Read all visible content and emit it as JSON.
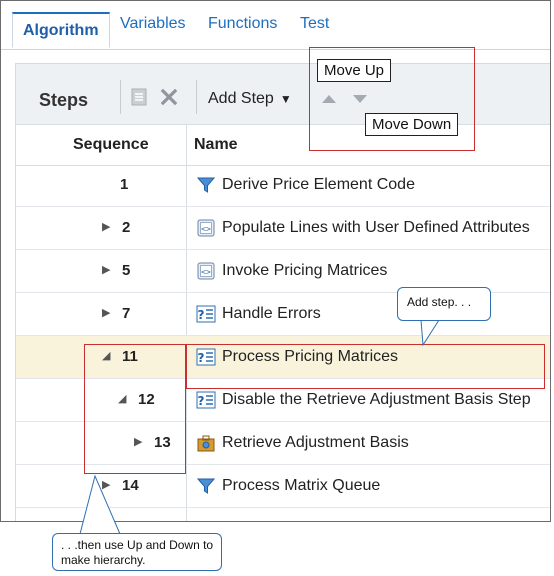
{
  "tabs": [
    {
      "label": "Algorithm",
      "active": true
    },
    {
      "label": "Variables",
      "active": false
    },
    {
      "label": "Functions",
      "active": false
    },
    {
      "label": "Test",
      "active": false
    }
  ],
  "toolbar": {
    "title": "Steps",
    "add_step_label": "Add Step",
    "icons": [
      "document-icon",
      "delete-x-icon",
      "move-up-arrow-icon",
      "move-down-arrow-icon"
    ]
  },
  "callouts": {
    "move_up": "Move Up",
    "move_down": "Move Down",
    "add_step_note": "Add step. . .",
    "hierarchy_note": ". . .then use Up and Down to make hierarchy."
  },
  "table": {
    "columns": [
      "Sequence",
      "Name"
    ],
    "rows": [
      {
        "seq": "1",
        "name": "Derive Price Element Code",
        "icon": "funnel-icon",
        "expander": "none",
        "selected": false
      },
      {
        "seq": "2",
        "name": "Populate Lines with User Defined Attributes",
        "icon": "code-block-icon",
        "expander": "collapsed",
        "selected": false
      },
      {
        "seq": "5",
        "name": "Invoke Pricing Matrices",
        "icon": "code-block-icon",
        "expander": "collapsed",
        "selected": false
      },
      {
        "seq": "7",
        "name": "Handle Errors",
        "icon": "condition-icon",
        "expander": "collapsed",
        "selected": false
      },
      {
        "seq": "11",
        "name": "Process Pricing Matrices",
        "icon": "condition-icon",
        "expander": "expanded",
        "selected": true
      },
      {
        "seq": "12",
        "name": "Disable the Retrieve Adjustment Basis Step",
        "icon": "condition-icon",
        "expander": "expanded",
        "selected": false
      },
      {
        "seq": "13",
        "name": "Retrieve Adjustment Basis",
        "icon": "database-icon",
        "expander": "collapsed",
        "selected": false
      },
      {
        "seq": "14",
        "name": "Process Matrix Queue",
        "icon": "funnel-icon",
        "expander": "collapsed",
        "selected": false
      }
    ]
  },
  "colors": {
    "accent": "#1f6dc0",
    "callout_red": "#c8302f",
    "selected_row": "#f8f3da",
    "panel_bg": "#eef1f4"
  }
}
